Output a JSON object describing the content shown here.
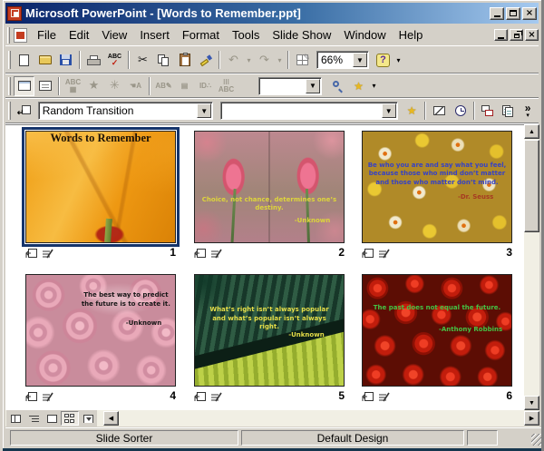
{
  "window": {
    "title": "Microsoft PowerPoint - [Words to Remember.ppt]"
  },
  "menu": {
    "items": [
      "File",
      "Edit",
      "View",
      "Insert",
      "Format",
      "Tools",
      "Slide Show",
      "Window",
      "Help"
    ]
  },
  "standard_toolbar": {
    "zoom_value": "66%"
  },
  "sorter_toolbar": {
    "transition_value": "Random Transition",
    "animation_value": ""
  },
  "slides": [
    {
      "number": "1",
      "title": "Words to Remember",
      "quote": "",
      "attribution": "",
      "text_color": "#1c1206"
    },
    {
      "number": "2",
      "quote": "Choice, not chance, determines one’s destiny.",
      "attribution": "-Unknown",
      "text_color": "#ddd53b"
    },
    {
      "number": "3",
      "quote": "Be who you are and say what you feel, because those who mind don’t matter and those who matter don’t mind.",
      "attribution": "-Dr. Seuss",
      "text_color": "#3642c4",
      "attribution_color": "#a63a22"
    },
    {
      "number": "4",
      "quote": "The best way to predict the future is to create it.",
      "attribution": "-Unknown",
      "text_color": "#161616"
    },
    {
      "number": "5",
      "quote": "What’s right isn’t always popular and what’s popular isn’t always right.",
      "attribution": "-Unknown",
      "text_color": "#e6de48"
    },
    {
      "number": "6",
      "quote": "The past does not equal the future.",
      "attribution": "-Anthony Robbins",
      "text_color": "#44c244"
    }
  ],
  "status_bar": {
    "view_label": "Slide Sorter",
    "design_label": "Default Design"
  },
  "colors": {
    "titlebar_left": "#0a246a",
    "titlebar_right": "#a6caf0",
    "chrome_face": "#d4d0c8",
    "selection_border": "#15346b"
  },
  "icons": {
    "app": "powerpoint-red-square",
    "standard": [
      "new",
      "open",
      "save",
      "print",
      "spelling",
      "cut",
      "copy",
      "paste",
      "format-painter",
      "undo",
      "redo",
      "tables-and-borders",
      "help"
    ],
    "sorter": [
      "slide-transition",
      "animation-preview",
      "hide-slide",
      "rehearse-timings",
      "summary-slide",
      "speaker-notes"
    ],
    "view_buttons": [
      "normal-view",
      "outline-view",
      "slide-view",
      "slide-sorter-view",
      "slide-show"
    ],
    "slide_indicators": [
      "transition-indicator",
      "animation-indicator"
    ]
  }
}
